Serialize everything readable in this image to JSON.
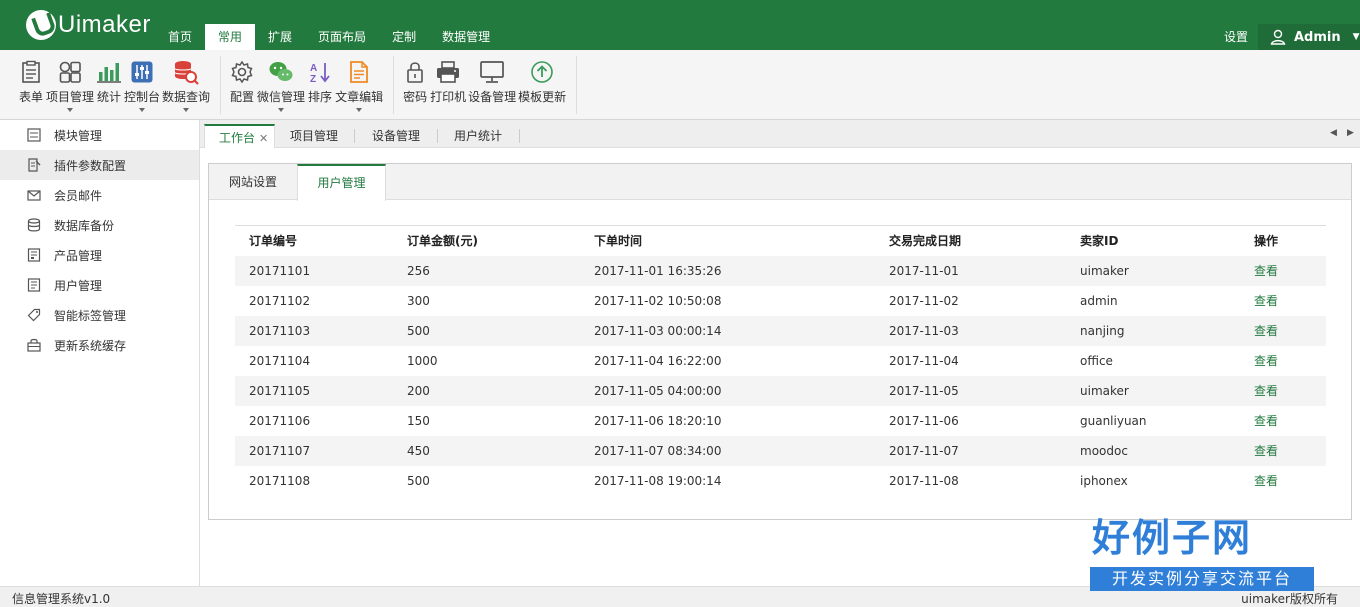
{
  "app": {
    "logo_text": "Uimaker"
  },
  "mainnav": [
    {
      "label": "首页"
    },
    {
      "label": "常用"
    },
    {
      "label": "扩展"
    },
    {
      "label": "页面布局"
    },
    {
      "label": "定制"
    },
    {
      "label": "数据管理"
    }
  ],
  "top_right": {
    "settings": "设置",
    "user": "Admin"
  },
  "toolbar": [
    {
      "label": "表单",
      "icon": "form-icon"
    },
    {
      "label": "项目管理",
      "icon": "grid-icon"
    },
    {
      "label": "统计",
      "icon": "bar-chart-icon"
    },
    {
      "label": "控制台",
      "icon": "sliders-icon"
    },
    {
      "label": "数据查询",
      "icon": "database-search-icon"
    },
    {
      "label": "配置",
      "icon": "gear-icon"
    },
    {
      "label": "微信管理",
      "icon": "wechat-icon"
    },
    {
      "label": "排序",
      "icon": "sort-az-icon"
    },
    {
      "label": "文章编辑",
      "icon": "document-edit-icon"
    },
    {
      "label": "密码",
      "icon": "lock-icon"
    },
    {
      "label": "打印机",
      "icon": "printer-icon"
    },
    {
      "label": "设备管理",
      "icon": "monitor-icon"
    },
    {
      "label": "模板更新",
      "icon": "upload-circle-icon"
    }
  ],
  "sidebar": [
    {
      "label": "模块管理",
      "icon": "module-icon"
    },
    {
      "label": "插件参数配置",
      "icon": "plugin-icon"
    },
    {
      "label": "会员邮件",
      "icon": "mail-icon"
    },
    {
      "label": "数据库备份",
      "icon": "database-icon"
    },
    {
      "label": "产品管理",
      "icon": "product-icon"
    },
    {
      "label": "用户管理",
      "icon": "user-doc-icon"
    },
    {
      "label": "智能标签管理",
      "icon": "tag-icon"
    },
    {
      "label": "更新系统缓存",
      "icon": "cache-icon"
    }
  ],
  "tabs": [
    {
      "label": "工作台"
    },
    {
      "label": "项目管理"
    },
    {
      "label": "设备管理"
    },
    {
      "label": "用户统计"
    }
  ],
  "subtabs": [
    {
      "label": "网站设置"
    },
    {
      "label": "用户管理"
    }
  ],
  "table": {
    "headers": [
      "订单编号",
      "订单金额(元)",
      "下单时间",
      "交易完成日期",
      "卖家ID",
      "操作"
    ],
    "rows": [
      [
        "20171101",
        "256",
        "2017-11-01 16:35:26",
        "2017-11-01",
        "uimaker",
        "查看"
      ],
      [
        "20171102",
        "300",
        "2017-11-02 10:50:08",
        "2017-11-02",
        "admin",
        "查看"
      ],
      [
        "20171103",
        "500",
        "2017-11-03 00:00:14",
        "2017-11-03",
        "nanjing",
        "查看"
      ],
      [
        "20171104",
        "1000",
        "2017-11-04 16:22:00",
        "2017-11-04",
        "office",
        "查看"
      ],
      [
        "20171105",
        "200",
        "2017-11-05 04:00:00",
        "2017-11-05",
        "uimaker",
        "查看"
      ],
      [
        "20171106",
        "150",
        "2017-11-06 18:20:10",
        "2017-11-06",
        "guanliyuan",
        "查看"
      ],
      [
        "20171107",
        "450",
        "2017-11-07 08:34:00",
        "2017-11-07",
        "moodoc",
        "查看"
      ],
      [
        "20171108",
        "500",
        "2017-11-08 19:00:14",
        "2017-11-08",
        "iphonex",
        "查看"
      ]
    ]
  },
  "footer": {
    "left": "信息管理系统v1.0",
    "right": "uimaker版权所有"
  },
  "badge": {
    "title": "好例子网",
    "subtitle": "开发实例分享交流平台"
  },
  "colors": {
    "brand": "#237a3f",
    "badge": "#2f7fd8"
  }
}
